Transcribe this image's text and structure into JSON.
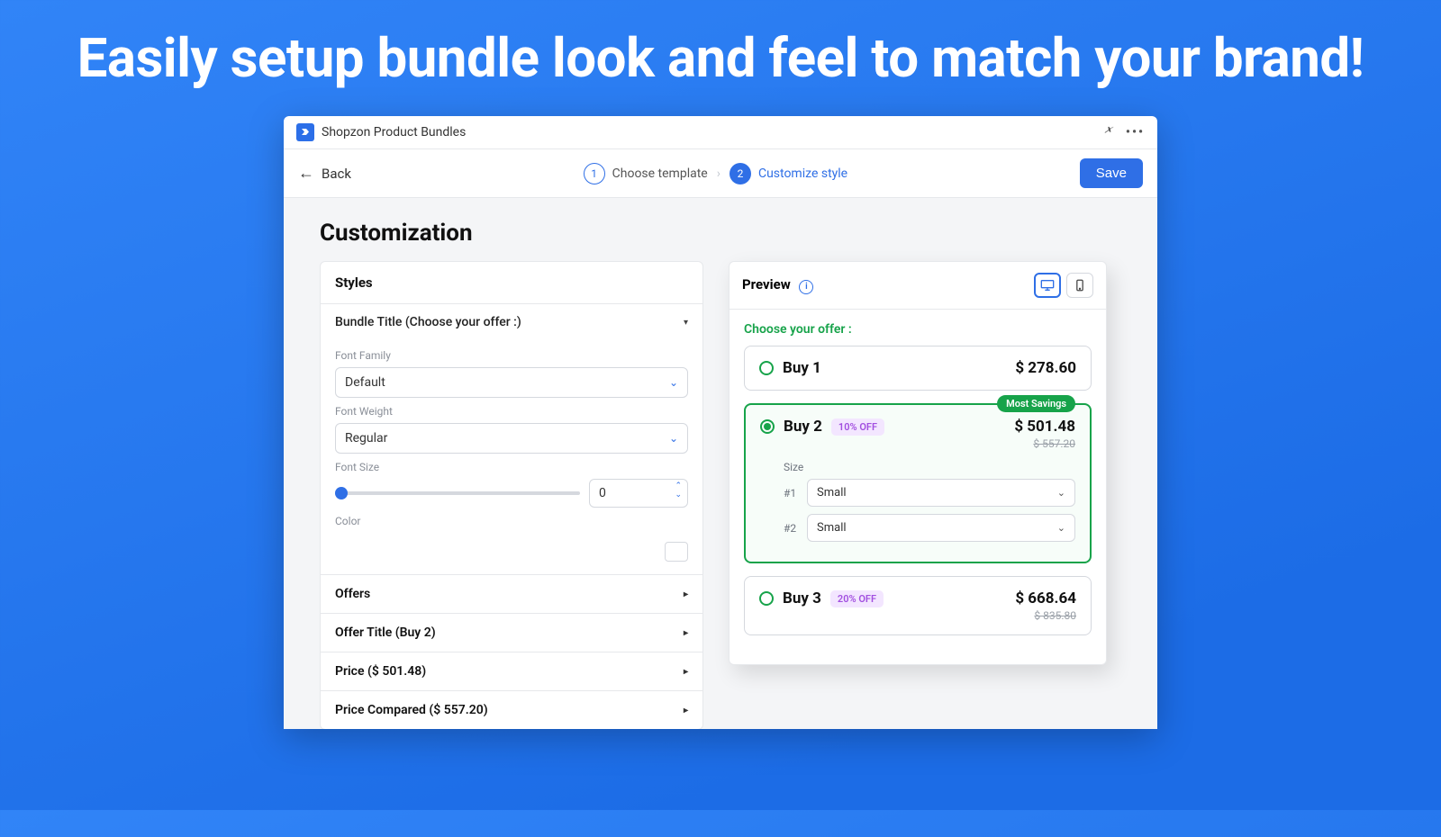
{
  "hero": "Easily setup bundle look and feel to match your brand!",
  "topbar": {
    "app_name": "Shopzon Product Bundles"
  },
  "wizard": {
    "back": "Back",
    "step1_num": "1",
    "step1_label": "Choose template",
    "step2_num": "2",
    "step2_label": "Customize style",
    "save_label": "Save"
  },
  "page_heading": "Customization",
  "styles_panel": {
    "header": "Styles",
    "bundle_title_row": "Bundle Title (Choose your offer :)",
    "font_family_label": "Font Family",
    "font_family_value": "Default",
    "font_weight_label": "Font Weight",
    "font_weight_value": "Regular",
    "font_size_label": "Font Size",
    "font_size_value": "0",
    "color_label": "Color",
    "offers_row": "Offers",
    "offer_title_row": "Offer Title (Buy 2)",
    "price_row": "Price ($ 501.48)",
    "price_compared_row": "Price Compared ($ 557.20)"
  },
  "preview": {
    "header": "Preview",
    "offer_heading": "Choose your offer :",
    "offer1": {
      "name": "Buy 1",
      "price": "$ 278.60"
    },
    "offer2": {
      "name": "Buy 2",
      "badge": "10% OFF",
      "price": "$ 501.48",
      "old_price": "$ 557.20",
      "savings": "Most Savings",
      "variant_label": "Size",
      "v1_index": "#1",
      "v1_value": "Small",
      "v2_index": "#2",
      "v2_value": "Small"
    },
    "offer3": {
      "name": "Buy 3",
      "badge": "20% OFF",
      "price": "$ 668.64",
      "old_price": "$ 835.80"
    }
  }
}
